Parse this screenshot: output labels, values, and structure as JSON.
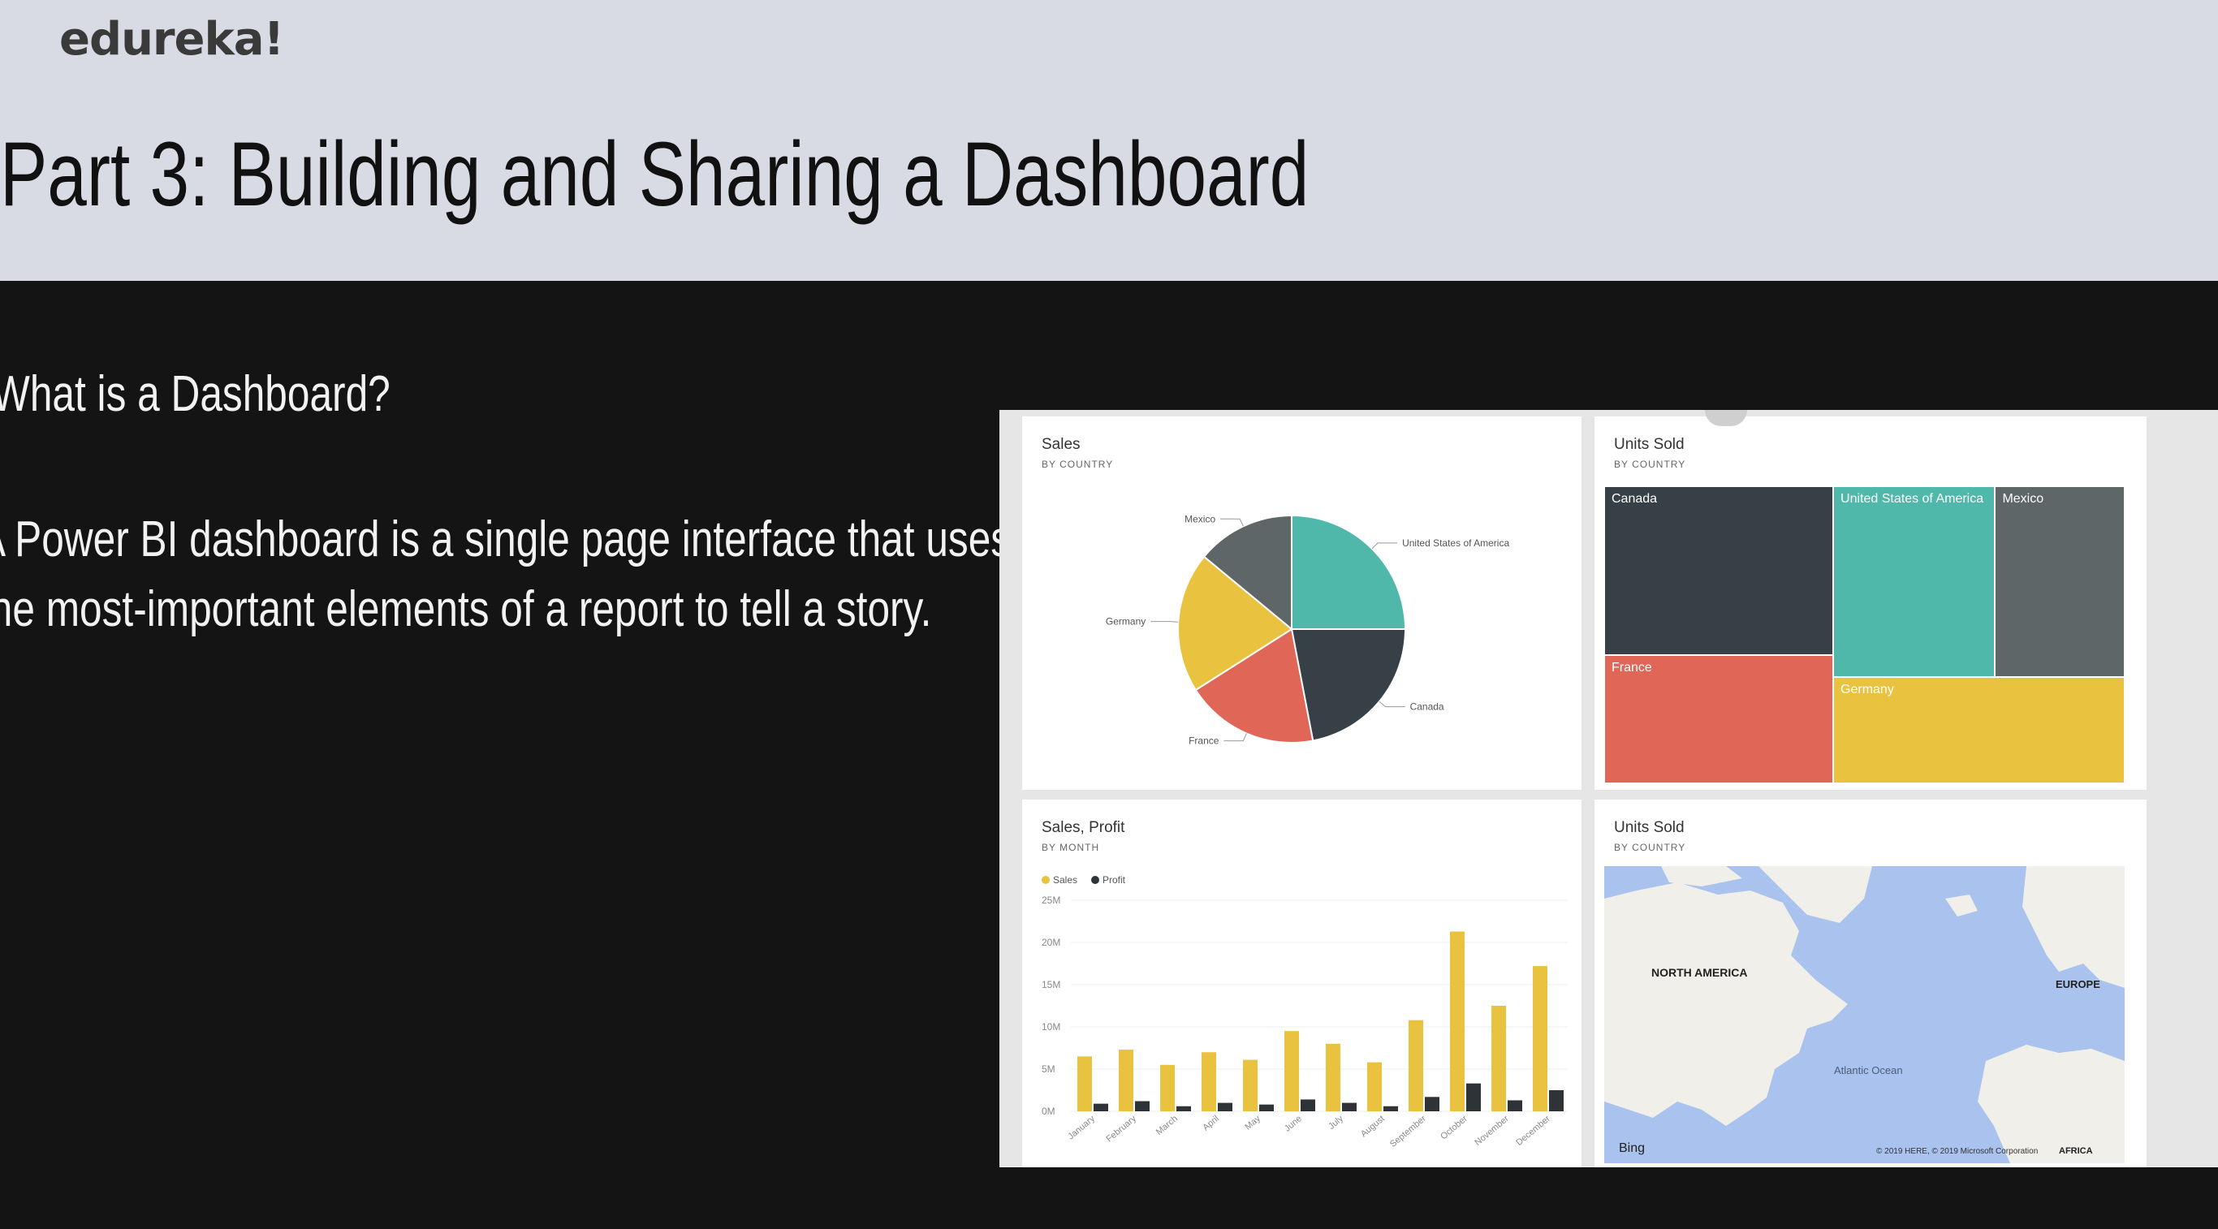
{
  "header": {
    "brand": "edureka!",
    "title": "Part 3: Building and Sharing a Dashboard"
  },
  "content": {
    "question": "What is a Dashboard?",
    "lines": [
      "A Power BI dashboard is a single page interface that uses",
      "the most-important elements of a report to tell a story."
    ]
  },
  "tiles": {
    "sales": {
      "title": "Sales",
      "subtitle": "BY COUNTRY"
    },
    "units": {
      "title": "Units Sold",
      "subtitle": "BY COUNTRY"
    },
    "profit": {
      "title": "Sales, Profit",
      "subtitle": "BY MONTH"
    },
    "map": {
      "title": "Units Sold",
      "subtitle": "BY COUNTRY",
      "labels": {
        "na": "NORTH AMERICA",
        "eu": "EUROPE",
        "ocean": "Atlantic Ocean",
        "bing": "Bing",
        "copyright": "© 2019 HERE, © 2019 Microsoft Corporation",
        "africa": "AFRICA"
      }
    }
  },
  "colors": {
    "usa": "#4fb8aa",
    "canada": "#374047",
    "france": "#e06757",
    "germany": "#e9c33f",
    "mexico": "#5f6668",
    "sales": "#e9c33f",
    "profit": "#2d3336"
  },
  "chart_data": [
    {
      "type": "pie",
      "title": "Sales",
      "subtitle": "BY COUNTRY",
      "slices": [
        {
          "label": "United States of America",
          "value": 25,
          "color": "#4fb8aa"
        },
        {
          "label": "Canada",
          "value": 22,
          "color": "#374047"
        },
        {
          "label": "France",
          "value": 19,
          "color": "#e06757"
        },
        {
          "label": "Germany",
          "value": 20,
          "color": "#e9c33f"
        },
        {
          "label": "Mexico",
          "value": 14,
          "color": "#5f6668"
        }
      ]
    },
    {
      "type": "treemap",
      "title": "Units Sold",
      "subtitle": "BY COUNTRY",
      "items": [
        {
          "label": "Canada",
          "value": 25,
          "color": "#374047"
        },
        {
          "label": "France",
          "value": 19,
          "color": "#e06757"
        },
        {
          "label": "United States of America",
          "value": 20,
          "color": "#4fb8aa"
        },
        {
          "label": "Mexico",
          "value": 16,
          "color": "#5f6668"
        },
        {
          "label": "Germany",
          "value": 20,
          "color": "#e9c33f"
        }
      ]
    },
    {
      "type": "bar",
      "title": "Sales, Profit",
      "subtitle": "BY MONTH",
      "categories": [
        "January",
        "February",
        "March",
        "April",
        "May",
        "June",
        "July",
        "August",
        "September",
        "October",
        "November",
        "December"
      ],
      "series": [
        {
          "name": "Sales",
          "color": "#e9c33f",
          "values": [
            6.5,
            7.3,
            5.5,
            7.0,
            6.1,
            9.5,
            8.0,
            5.8,
            10.8,
            21.3,
            12.5,
            17.2
          ]
        },
        {
          "name": "Profit",
          "color": "#2d3336",
          "values": [
            0.9,
            1.2,
            0.6,
            1.0,
            0.8,
            1.4,
            1.0,
            0.6,
            1.7,
            3.3,
            1.3,
            2.5
          ]
        }
      ],
      "yticks": [
        "0M",
        "5M",
        "10M",
        "15M",
        "20M",
        "25M"
      ],
      "ylim": [
        0,
        25
      ]
    }
  ]
}
